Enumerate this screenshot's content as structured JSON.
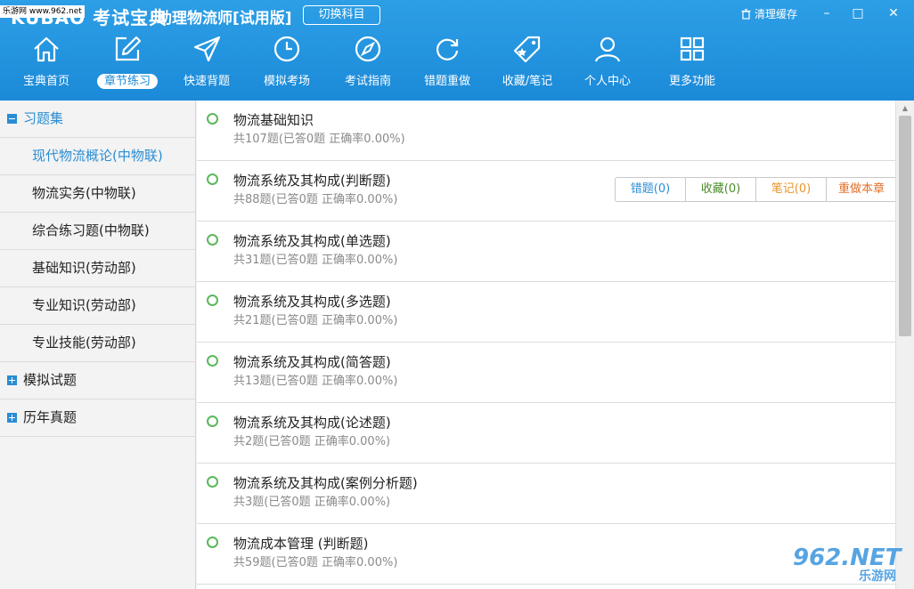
{
  "titlebar": {
    "watermark": "乐游网 www.962.net",
    "logo": "KUBAO 考试宝典",
    "app_title": "助理物流师[试用版]",
    "switch_subject": "切换科目",
    "clear_cache": "清理缓存",
    "minimize": "–",
    "maximize": "□",
    "close": "✕"
  },
  "nav": [
    {
      "label": "宝典首页",
      "icon": "home-icon"
    },
    {
      "label": "章节练习",
      "icon": "edit-icon",
      "active": true
    },
    {
      "label": "快速背题",
      "icon": "send-icon"
    },
    {
      "label": "模拟考场",
      "icon": "clock-icon"
    },
    {
      "label": "考试指南",
      "icon": "compass-icon"
    },
    {
      "label": "错题重做",
      "icon": "refresh-icon"
    },
    {
      "label": "收藏/笔记",
      "icon": "tag-icon"
    },
    {
      "label": "个人中心",
      "icon": "user-icon"
    },
    {
      "label": "更多功能",
      "icon": "grid-icon"
    }
  ],
  "sidebar": {
    "groups": [
      {
        "label": "习题集",
        "expanded": true
      },
      {
        "label": "模拟试题",
        "expanded": false
      },
      {
        "label": "历年真题",
        "expanded": false
      }
    ],
    "children": [
      {
        "label": "现代物流概论(中物联)",
        "selected": true
      },
      {
        "label": "物流实务(中物联)"
      },
      {
        "label": "综合练习题(中物联)"
      },
      {
        "label": "基础知识(劳动部)"
      },
      {
        "label": "专业知识(劳动部)"
      },
      {
        "label": "专业技能(劳动部)"
      }
    ]
  },
  "chapters": [
    {
      "title": "物流基础知识",
      "stats": "共107题(已答0题   正确率0.00%)"
    },
    {
      "title": "物流系统及其构成(判断题)",
      "stats": "共88题(已答0题   正确率0.00%)"
    },
    {
      "title": "物流系统及其构成(单选题)",
      "stats": "共31题(已答0题   正确率0.00%)"
    },
    {
      "title": "物流系统及其构成(多选题)",
      "stats": "共21题(已答0题   正确率0.00%)"
    },
    {
      "title": "物流系统及其构成(简答题)",
      "stats": "共13题(已答0题   正确率0.00%)"
    },
    {
      "title": "物流系统及其构成(论述题)",
      "stats": "共2题(已答0题   正确率0.00%)"
    },
    {
      "title": "物流系统及其构成(案例分析题)",
      "stats": "共3题(已答0题   正确率0.00%)"
    },
    {
      "title": "物流成本管理 (判断题)",
      "stats": "共59题(已答0题   正确率0.00%)"
    }
  ],
  "row_actions": {
    "wrong": "错题(0)",
    "favorite": "收藏(0)",
    "notes": "笔记(0)",
    "redo": "重做本章",
    "colors": {
      "wrong": "#2a8dd4",
      "favorite": "#4a8c2a",
      "notes": "#e8962a",
      "redo": "#e0702a"
    }
  },
  "corner_logo": {
    "big": "962.NET",
    "small": "乐游网"
  },
  "colors": {
    "header": "#1b8ad8",
    "accent": "#2a8dd4",
    "circle": "#5cb85c"
  }
}
